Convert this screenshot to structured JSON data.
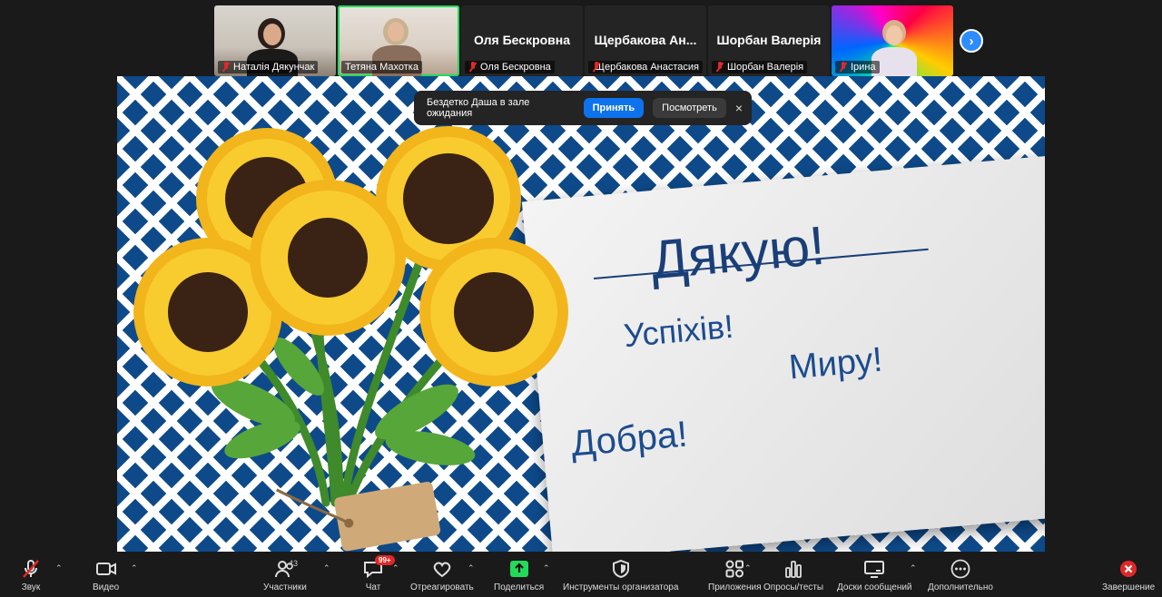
{
  "participants": [
    {
      "name": "Наталія Дякунчак",
      "muted": true
    },
    {
      "name": "Тетяна Махотка",
      "muted": false
    },
    {
      "name": "Оля Бескровна",
      "big_name": "Оля Бескровна",
      "muted": true
    },
    {
      "name": "Щербакова Анастасия",
      "big_name": "Щербакова Ан...",
      "muted": true
    },
    {
      "name": "Шорбан Валерія",
      "big_name": "Шорбан Валерія",
      "muted": true
    },
    {
      "name": "Ірина",
      "muted": true
    }
  ],
  "waiting_room": {
    "message": "Бездетко Даша в зале ожидания",
    "accept": "Принять",
    "view": "Посмотреть",
    "close": "×"
  },
  "slide": {
    "title": "Дякую!",
    "line1": "Успіхів!",
    "line2": "Миру!",
    "line3": "Добра!"
  },
  "toolbar": {
    "audio": "Звук",
    "video": "Видео",
    "participants": "Участники",
    "participants_count": "43",
    "chat": "Чат",
    "chat_badge": "99+",
    "react": "Отреагировать",
    "share": "Поделиться",
    "host_tools": "Инструменты организатора",
    "apps": "Приложения",
    "polls": "Опросы/тесты",
    "whiteboards": "Доски сообщений",
    "more": "Дополнительно",
    "end": "Завершение"
  },
  "icons": {
    "audio": "mic-muted-icon",
    "video": "camera-icon",
    "participants": "people-icon",
    "chat": "chat-bubble-icon",
    "react": "heart-icon",
    "share": "share-arrow-icon",
    "host_tools": "shield-icon",
    "apps": "apps-icon",
    "polls": "bar-chart-icon",
    "whiteboards": "whiteboard-icon",
    "more": "ellipsis-icon",
    "end": "close-circle-icon",
    "next": "chevron-right-icon"
  },
  "colors": {
    "accent": "#0e72ed",
    "active_speaker": "#23d959",
    "muted": "#e02828",
    "slide_blue": "#0e4a8a"
  }
}
